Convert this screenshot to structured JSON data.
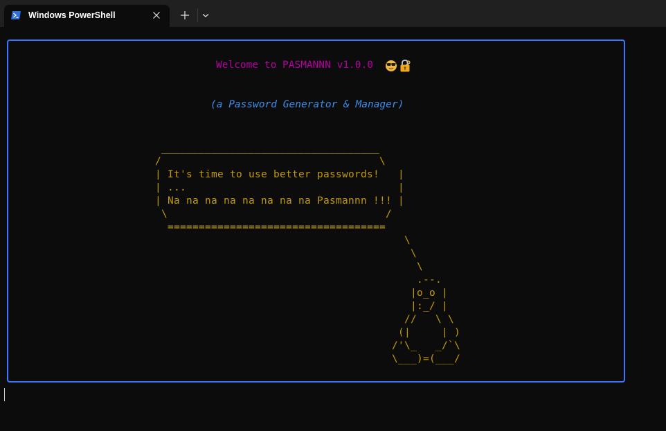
{
  "window": {
    "tab_title": "Windows PowerShell",
    "tab_icon": "powershell-icon",
    "close_icon": "close-icon",
    "new_tab_icon": "plus-icon",
    "dropdown_icon": "chevron-down-icon"
  },
  "terminal": {
    "welcome": "Welcome to PASMANNN v1.0.0",
    "welcome_emoji": [
      "sunglasses-face-icon",
      "locked-with-key-icon"
    ],
    "subtitle": "(a Password Generator & Manager)",
    "ascii_art": " ___________________________________\n/                                   \\\n| It's time to use better passwords!   |\n| ...                                  |\n| Na na na na na na na na Pasmannn !!! |\n \\                                   /\n  ===================================\n                                        \\\n                                         \\\n                                          \\\n                                          .--.\n                                         |o_o |\n                                         |:_/ |\n                                        //   \\ \\\n                                       (|     | )\n                                      /'\\_   _/`\\\n                                      \\___)=(___/",
    "colors": {
      "welcome": "#b4009e",
      "subtitle": "#3b8eea",
      "ascii": "#c19c00",
      "frame_border": "#3b78ff",
      "background": "#0c0c0c"
    }
  }
}
